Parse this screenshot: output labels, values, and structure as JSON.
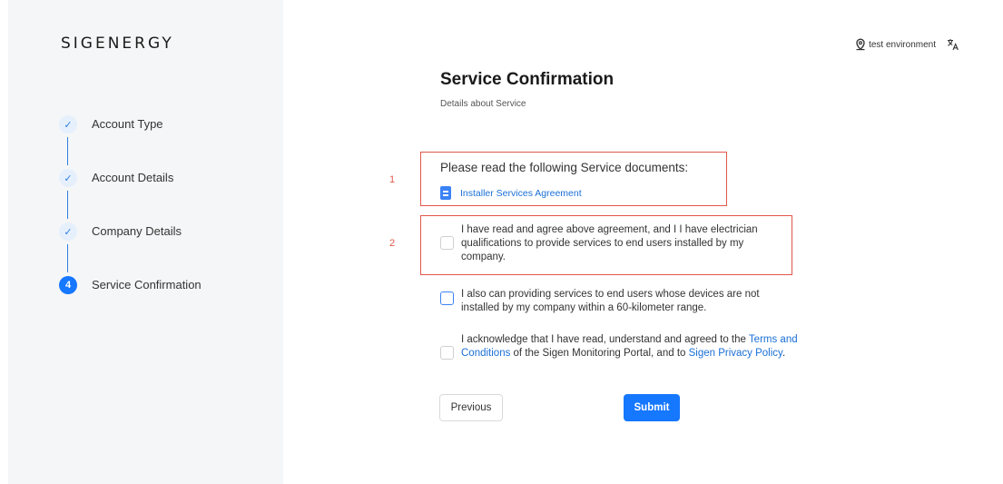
{
  "brand": {
    "logo": "SIGENERGY"
  },
  "topbar": {
    "environment": "test environment"
  },
  "steps": [
    {
      "label": "Account Type",
      "status": "done"
    },
    {
      "label": "Account Details",
      "status": "done"
    },
    {
      "label": "Company Details",
      "status": "done"
    },
    {
      "label": "Service Confirmation",
      "status": "active",
      "number": "4"
    }
  ],
  "main": {
    "title": "Service Confirmation",
    "subtitle": "Details about Service",
    "documents_heading": "Please read the following Service documents:",
    "document_link": "Installer Services Agreement",
    "markers": [
      "1",
      "2"
    ],
    "checks": {
      "c1": "I have read and agree above agreement, and I I have electrician qualifications to provide services to end users installed by my company.",
      "c2": "I also can providing services to end users whose devices are not installed by my company within a 60-kilometer range.",
      "c3_pre": "I acknowledge that I have read, understand and agreed to the ",
      "c3_link1": "Terms and Conditions",
      "c3_mid": " of the Sigen Monitoring Portal, and to ",
      "c3_link2": "Sigen Privacy Policy",
      "c3_post": "."
    },
    "buttons": {
      "previous": "Previous",
      "submit": "Submit"
    }
  },
  "colors": {
    "accent": "#1677ff",
    "highlight_box": "#e0574a",
    "sidebar_bg": "#f5f6f7"
  }
}
